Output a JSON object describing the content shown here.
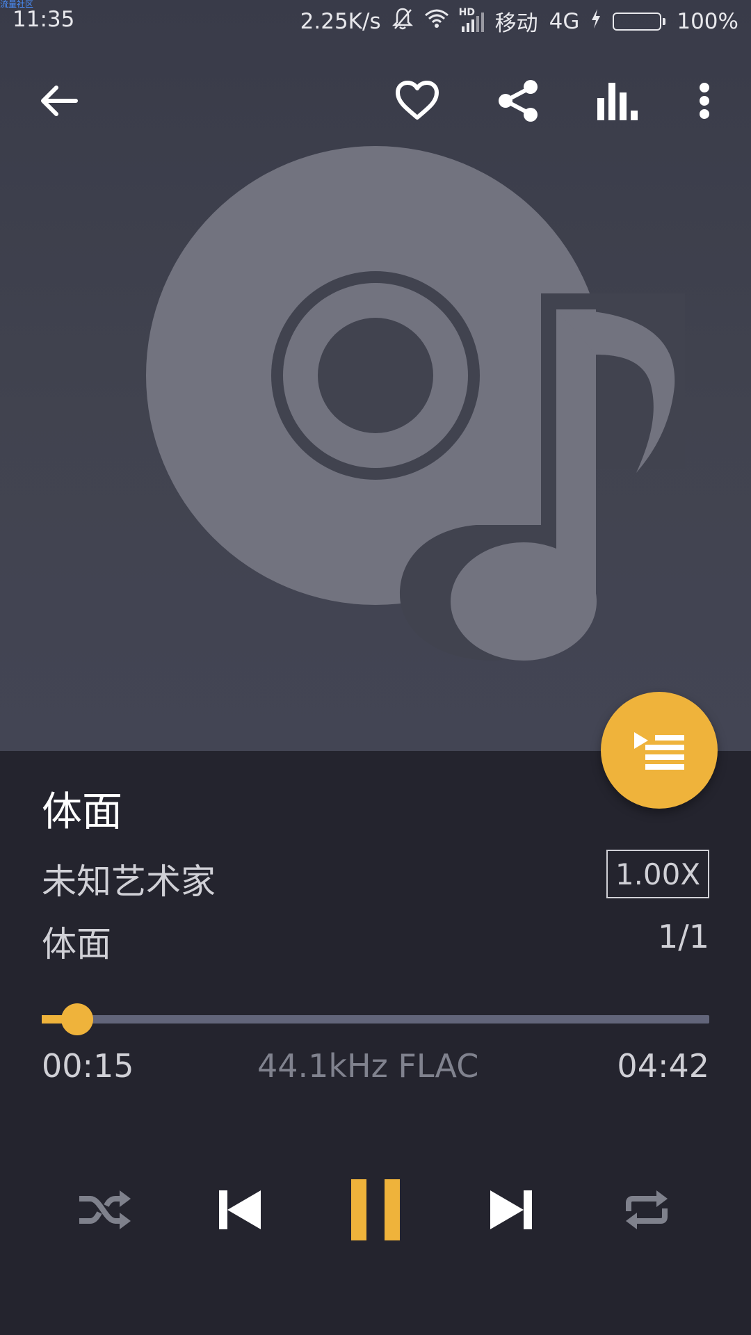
{
  "watermark": "流量社区",
  "status": {
    "time": "11:35",
    "net_speed": "2.25K/s",
    "hd": "HD",
    "carrier": "移动",
    "network": "4G",
    "battery_text": "100%",
    "battery_level": 1.0
  },
  "toolbar": {
    "back_icon": "arrow-left-icon",
    "favorite_icon": "heart-outline-icon",
    "share_icon": "share-icon",
    "equalizer_icon": "equalizer-icon",
    "more_icon": "more-vert-icon"
  },
  "artwork": {
    "icon": "disc-music-note-icon"
  },
  "playlist_fab": {
    "icon": "queue-play-icon",
    "color": "#efb33b"
  },
  "track": {
    "title": "体面",
    "artist": "未知艺术家",
    "album": "体面",
    "speed": "1.00X",
    "count": "1/1"
  },
  "progress": {
    "current": "00:15",
    "total": "04:42",
    "format": "44.1kHz FLAC",
    "fraction": 0.053
  },
  "controls": {
    "shuffle_icon": "shuffle-icon",
    "previous_icon": "skip-previous-icon",
    "pause_icon": "pause-icon",
    "next_icon": "skip-next-icon",
    "repeat_icon": "repeat-icon"
  },
  "colors": {
    "accent": "#efb33b",
    "background": "#24242e",
    "header": "#41434f"
  }
}
